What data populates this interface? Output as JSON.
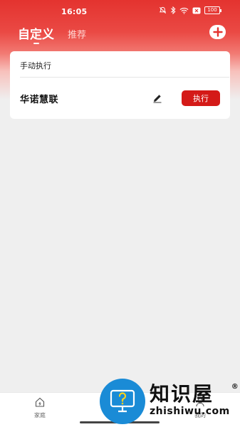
{
  "status_bar": {
    "time": "16:05",
    "battery": "100",
    "icons": [
      "mute-icon",
      "bluetooth-icon",
      "wifi-icon",
      "screen-record-icon",
      "battery-icon"
    ]
  },
  "header": {
    "tabs": [
      {
        "label": "自定义",
        "active": true
      },
      {
        "label": "推荐",
        "active": false
      }
    ],
    "add_icon": "plus-circle-icon"
  },
  "card": {
    "section_title": "手动执行",
    "items": [
      {
        "name": "华诺慧联",
        "action_label": "执行",
        "edit_icon": "pencil-icon"
      }
    ]
  },
  "bottom_nav": {
    "items": [
      {
        "label": "家庭",
        "icon": "home-icon"
      },
      {
        "label": "我的",
        "icon": "profile-icon"
      }
    ]
  },
  "watermark": {
    "cn_text": "知识屋",
    "en_text": "zhishiwu.com",
    "reg_mark": "®"
  },
  "colors": {
    "brand_red": "#e4332f",
    "button_red": "#d41a18",
    "background": "#efefef",
    "watermark_blue": "#1a8bd6"
  }
}
